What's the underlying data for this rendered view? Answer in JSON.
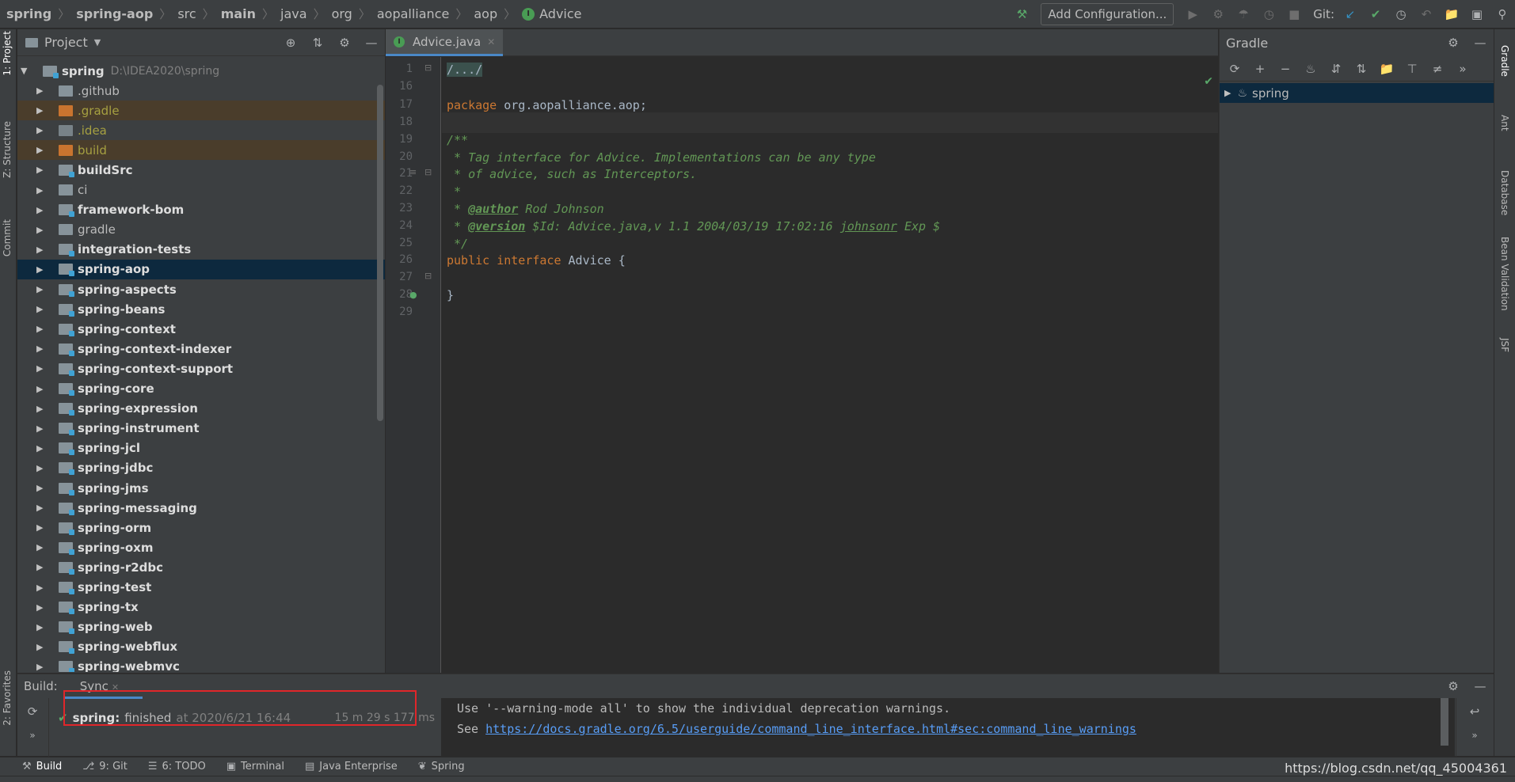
{
  "breadcrumbs": [
    {
      "label": "spring",
      "bold": true
    },
    {
      "label": "spring-aop",
      "bold": true
    },
    {
      "label": "src",
      "bold": false
    },
    {
      "label": "main",
      "bold": true
    },
    {
      "label": "java",
      "bold": false
    },
    {
      "label": "org",
      "bold": false
    },
    {
      "label": "aopalliance",
      "bold": false
    },
    {
      "label": "aop",
      "bold": false
    },
    {
      "label": "Advice",
      "bold": false
    }
  ],
  "toolbar": {
    "add_configuration": "Add Configuration...",
    "git_label": "Git:"
  },
  "left_strip": {
    "project": "1: Project",
    "structure": "Z: Structure",
    "commit": "Commit",
    "favorites": "2: Favorites"
  },
  "right_strip": {
    "gradle": "Gradle",
    "ant": "Ant",
    "database": "Database",
    "bean_validation": "Bean Validation",
    "jsf": "JSF"
  },
  "project_panel": {
    "title": "Project",
    "root": {
      "label": "spring",
      "path": "D:\\IDEA2020\\spring"
    },
    "items": [
      {
        "label": ".github",
        "kind": "plain"
      },
      {
        "label": ".gradle",
        "kind": "excluded"
      },
      {
        "label": ".idea",
        "kind": "idea"
      },
      {
        "label": "build",
        "kind": "excluded"
      },
      {
        "label": "buildSrc",
        "kind": "module"
      },
      {
        "label": "ci",
        "kind": "plain"
      },
      {
        "label": "framework-bom",
        "kind": "module"
      },
      {
        "label": "gradle",
        "kind": "plain"
      },
      {
        "label": "integration-tests",
        "kind": "module"
      },
      {
        "label": "spring-aop",
        "kind": "module",
        "selected": true
      },
      {
        "label": "spring-aspects",
        "kind": "module"
      },
      {
        "label": "spring-beans",
        "kind": "module"
      },
      {
        "label": "spring-context",
        "kind": "module"
      },
      {
        "label": "spring-context-indexer",
        "kind": "module"
      },
      {
        "label": "spring-context-support",
        "kind": "module"
      },
      {
        "label": "spring-core",
        "kind": "module"
      },
      {
        "label": "spring-expression",
        "kind": "module"
      },
      {
        "label": "spring-instrument",
        "kind": "module"
      },
      {
        "label": "spring-jcl",
        "kind": "module"
      },
      {
        "label": "spring-jdbc",
        "kind": "module"
      },
      {
        "label": "spring-jms",
        "kind": "module"
      },
      {
        "label": "spring-messaging",
        "kind": "module"
      },
      {
        "label": "spring-orm",
        "kind": "module"
      },
      {
        "label": "spring-oxm",
        "kind": "module"
      },
      {
        "label": "spring-r2dbc",
        "kind": "module"
      },
      {
        "label": "spring-test",
        "kind": "module"
      },
      {
        "label": "spring-tx",
        "kind": "module"
      },
      {
        "label": "spring-web",
        "kind": "module"
      },
      {
        "label": "spring-webflux",
        "kind": "module"
      },
      {
        "label": "spring-webmvc",
        "kind": "module"
      }
    ]
  },
  "editor": {
    "tab_title": "Advice.java",
    "lines": [
      {
        "num": "1",
        "html": "<span class=\"fold\">/.../</span>"
      },
      {
        "num": "16",
        "html": ""
      },
      {
        "num": "17",
        "html": "<span class=\"kw\">package</span> org.aopalliance.aop;"
      },
      {
        "num": "18",
        "html": "",
        "caret": true
      },
      {
        "num": "19",
        "html": "<span class=\"doc\">/**</span>"
      },
      {
        "num": "20",
        "html": "<span class=\"doc\"> * Tag interface for Advice. Implementations can be any type</span>"
      },
      {
        "num": "21",
        "html": "<span class=\"doc\"> * of advice, such as Interceptors.</span>"
      },
      {
        "num": "22",
        "html": "<span class=\"doc\"> *</span>"
      },
      {
        "num": "23",
        "html": "<span class=\"doc\"> * </span><span class=\"tag\">@author</span><span class=\"doc\"> Rod Johnson</span>"
      },
      {
        "num": "24",
        "html": "<span class=\"doc\"> * </span><span class=\"tag\">@version</span><span class=\"doc\"> $Id: Advice.java,v 1.1 2004/03/19 17:02:16 </span><span class=\"doc underline\">johnsonr</span><span class=\"doc\"> Exp $</span>"
      },
      {
        "num": "25",
        "html": "<span class=\"doc\"> */</span>"
      },
      {
        "num": "26",
        "html": "<span class=\"kw\">public interface</span> Advice {"
      },
      {
        "num": "27",
        "html": ""
      },
      {
        "num": "28",
        "html": "}"
      },
      {
        "num": "29",
        "html": ""
      }
    ]
  },
  "gradle_panel": {
    "title": "Gradle",
    "root_label": "spring"
  },
  "build_window": {
    "label": "Build:",
    "sync_tab": "Sync",
    "project": "spring:",
    "status": "finished",
    "at": "at 2020/6/21 16:44",
    "duration": "15 m 29 s 177 ms",
    "console_line1": "Use '--warning-mode all' to show the individual deprecation warnings.",
    "console_see": "See ",
    "console_link": "https://docs.gradle.org/6.5/userguide/command_line_interface.html#sec:command_line_warnings"
  },
  "bottom_tabs": [
    {
      "label": "Build",
      "icon": "hammer-icon",
      "active": true
    },
    {
      "label": "9: Git",
      "icon": "git-branch-icon"
    },
    {
      "label": "6: TODO",
      "icon": "todo-icon"
    },
    {
      "label": "Terminal",
      "icon": "terminal-icon"
    },
    {
      "label": "Java Enterprise",
      "icon": "java-enterprise-icon"
    },
    {
      "label": "Spring",
      "icon": "spring-leaf-icon"
    }
  ],
  "watermark": "https://blog.csdn.net/qq_45004361",
  "colors": {
    "accent": "#4a88c7",
    "selection": "#0d293e",
    "success": "#59a869",
    "highlight_box": "#e0262a"
  }
}
